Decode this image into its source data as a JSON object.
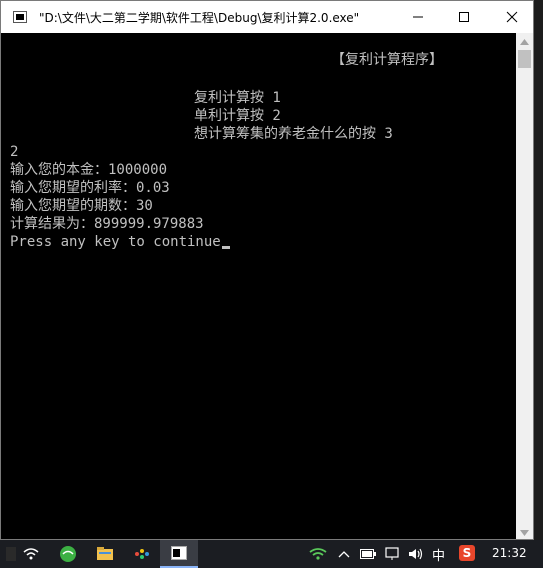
{
  "window": {
    "title": "\"D:\\文件\\大二第二学期\\软件工程\\Debug\\复利计算2.0.exe\"",
    "minimize_label": "minimize",
    "maximize_label": "maximize",
    "close_label": "close"
  },
  "console": {
    "heading": "【复利计算程序】",
    "menu": [
      "复利计算按 1",
      "单利计算按 2",
      "想计算筹集的养老金什么的按 3"
    ],
    "choice": "2",
    "principal": "输入您的本金：1000000",
    "rate": "输入您期望的利率：0.03",
    "periods": "输入您期望的期数：30",
    "result": "计算结果为：899999.979883",
    "continue_prompt": "Press any key to continue"
  },
  "taskbar": {
    "time": "21:32",
    "ime": "中",
    "sogou": "S"
  },
  "colors": {
    "console_bg": "#000000",
    "console_text": "#c0c0c0",
    "taskbar_bg": "#1b1d22"
  }
}
